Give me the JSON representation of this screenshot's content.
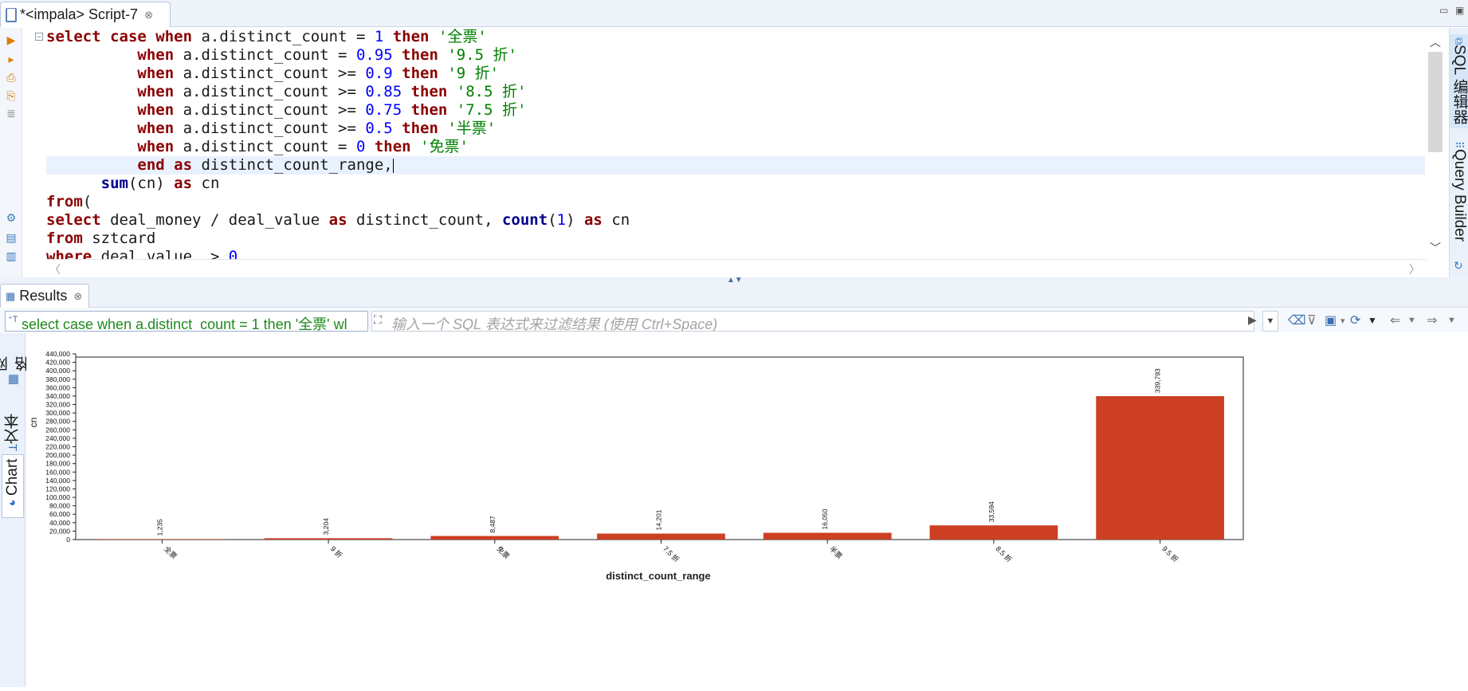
{
  "editor": {
    "tab_title": "*<impala> Script-7",
    "tab_close": "⊗",
    "code_lines": [
      [
        [
          "kw",
          "select "
        ],
        [
          "kw",
          "case "
        ],
        [
          "kw",
          "when "
        ],
        [
          "t",
          "a.distinct_count = "
        ],
        [
          "num",
          "1"
        ],
        [
          "t",
          " "
        ],
        [
          "kw",
          "then "
        ],
        [
          "str",
          "'全票'"
        ]
      ],
      [
        [
          "t",
          "          "
        ],
        [
          "kw",
          "when "
        ],
        [
          "t",
          "a.distinct_count = "
        ],
        [
          "num",
          "0.95"
        ],
        [
          "t",
          " "
        ],
        [
          "kw",
          "then "
        ],
        [
          "str",
          "'9.5 折'"
        ]
      ],
      [
        [
          "t",
          "          "
        ],
        [
          "kw",
          "when "
        ],
        [
          "t",
          "a.distinct_count >= "
        ],
        [
          "num",
          "0.9"
        ],
        [
          "t",
          " "
        ],
        [
          "kw",
          "then "
        ],
        [
          "str",
          "'9 折'"
        ]
      ],
      [
        [
          "t",
          "          "
        ],
        [
          "kw",
          "when "
        ],
        [
          "t",
          "a.distinct_count >= "
        ],
        [
          "num",
          "0.85"
        ],
        [
          "t",
          " "
        ],
        [
          "kw",
          "then "
        ],
        [
          "str",
          "'8.5 折'"
        ]
      ],
      [
        [
          "t",
          "          "
        ],
        [
          "kw",
          "when "
        ],
        [
          "t",
          "a.distinct_count >= "
        ],
        [
          "num",
          "0.75"
        ],
        [
          "t",
          " "
        ],
        [
          "kw",
          "then "
        ],
        [
          "str",
          "'7.5 折'"
        ]
      ],
      [
        [
          "t",
          "          "
        ],
        [
          "kw",
          "when "
        ],
        [
          "t",
          "a.distinct_count >= "
        ],
        [
          "num",
          "0.5"
        ],
        [
          "t",
          " "
        ],
        [
          "kw",
          "then "
        ],
        [
          "str",
          "'半票'"
        ]
      ],
      [
        [
          "t",
          "          "
        ],
        [
          "kw",
          "when "
        ],
        [
          "t",
          "a.distinct_count = "
        ],
        [
          "num",
          "0"
        ],
        [
          "t",
          " "
        ],
        [
          "kw",
          "then "
        ],
        [
          "str",
          "'免票'"
        ]
      ],
      [
        [
          "t",
          "          "
        ],
        [
          "kw",
          "end "
        ],
        [
          "kw",
          "as "
        ],
        [
          "t",
          "distinct_count_range,"
        ],
        [
          "caret",
          ""
        ]
      ],
      [
        [
          "t",
          "      "
        ],
        [
          "kw2",
          "sum"
        ],
        [
          "t",
          "(cn) "
        ],
        [
          "kw",
          "as "
        ],
        [
          "t",
          "cn"
        ]
      ],
      [
        [
          "kw",
          "from"
        ],
        [
          "t",
          "("
        ]
      ],
      [
        [
          "kw",
          "select "
        ],
        [
          "t",
          "deal_money / deal_value "
        ],
        [
          "kw",
          "as "
        ],
        [
          "t",
          "distinct_count, "
        ],
        [
          "kw2",
          "count"
        ],
        [
          "t",
          "("
        ],
        [
          "num",
          "1"
        ],
        [
          "t",
          ") "
        ],
        [
          "kw",
          "as "
        ],
        [
          "t",
          "cn"
        ]
      ],
      [
        [
          "kw",
          "from "
        ],
        [
          "t",
          "sztcard"
        ]
      ],
      [
        [
          "kw",
          "where "
        ],
        [
          "t",
          "deal_value  > "
        ],
        [
          "num",
          "0"
        ]
      ]
    ],
    "current_line": 7,
    "side_tabs": [
      "SQL 编辑器",
      "Query Builder"
    ]
  },
  "results": {
    "tab_label": "Results",
    "tab_close": "⊗",
    "query_text": "select case when a.distinct_count = 1 then '全票' wl",
    "filter_placeholder": "输入一个 SQL 表达式来过滤结果 (使用 Ctrl+Space)",
    "view_tabs": [
      {
        "label": "网格",
        "icon": "grid-icon",
        "active": false
      },
      {
        "label": "文本",
        "icon": "text-icon",
        "active": false
      },
      {
        "label": "Chart",
        "icon": "pie-icon",
        "active": true
      }
    ]
  },
  "chart_data": {
    "type": "bar",
    "categories": [
      "全票",
      "9 折",
      "免票",
      "7.5 折",
      "半票",
      "8.5 折",
      "9.5 折"
    ],
    "values": [
      1235,
      3204,
      8487,
      14201,
      16050,
      33594,
      339793
    ],
    "data_labels": [
      "1,235",
      "3,204",
      "8,487",
      "14,201",
      "16,050",
      "33,594",
      "339,793"
    ],
    "xlabel": "distinct_count_range",
    "ylabel": "cn",
    "ylim": [
      0,
      440000
    ],
    "yticks": [
      0,
      20000,
      40000,
      60000,
      80000,
      100000,
      120000,
      140000,
      160000,
      180000,
      200000,
      220000,
      240000,
      260000,
      280000,
      300000,
      320000,
      340000,
      360000,
      380000,
      400000,
      420000,
      440000
    ],
    "ytick_labels": [
      "0",
      "20,000",
      "40,000",
      "60,000",
      "80,000",
      "100,000",
      "120,000",
      "140,000",
      "160,000",
      "180,000",
      "200,000",
      "220,000",
      "240,000",
      "260,000",
      "280,000",
      "300,000",
      "320,000",
      "340,000",
      "360,000",
      "380,000",
      "400,000",
      "420,000",
      "440,000"
    ],
    "bar_color": "#cc3f22",
    "grid": false,
    "legend": "none"
  }
}
